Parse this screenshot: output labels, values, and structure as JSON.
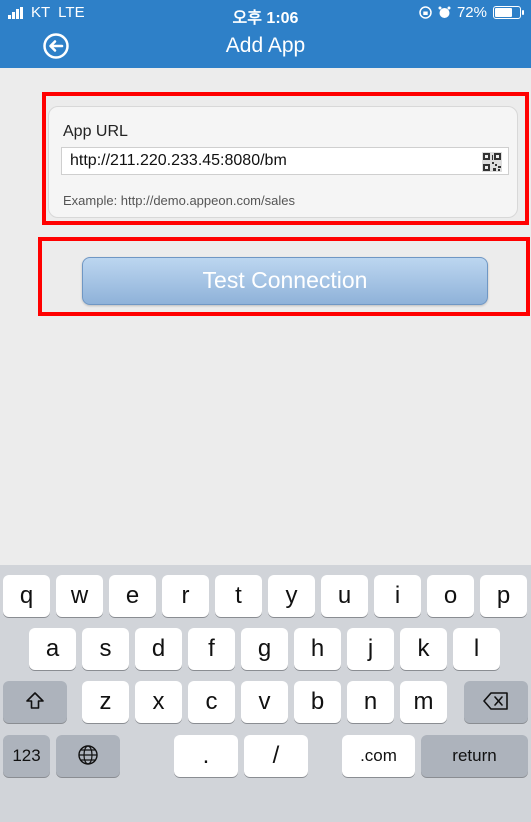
{
  "status_bar": {
    "carrier": "KT",
    "network": "LTE",
    "time": "오후 1:06",
    "battery_percent": "72%",
    "battery_level": 0.72
  },
  "nav": {
    "title": "Add App",
    "back_icon": "back-arrow-circle-icon"
  },
  "form": {
    "label": "App URL",
    "url_value": "http://211.220.233.45:8080/bm",
    "qr_icon": "qr-code-icon",
    "example": "Example: http://demo.appeon.com/sales"
  },
  "test_button": {
    "label": "Test Connection"
  },
  "colors": {
    "header_bg": "#2e80c8",
    "highlight": "#ff0000",
    "button_top": "#bcd6f0",
    "button_bottom": "#8fb2d9"
  },
  "keyboard": {
    "row1": [
      "q",
      "w",
      "e",
      "r",
      "t",
      "y",
      "u",
      "i",
      "o",
      "p"
    ],
    "row2": [
      "a",
      "s",
      "d",
      "f",
      "g",
      "h",
      "j",
      "k",
      "l"
    ],
    "row3": [
      "z",
      "x",
      "c",
      "v",
      "b",
      "n",
      "m"
    ],
    "shift_icon": "shift-icon",
    "delete_icon": "delete-icon",
    "globe_icon": "globe-icon",
    "numbers": "123",
    "dot": ".",
    "slash": "/",
    "dotcom": ".com",
    "return": "return"
  }
}
